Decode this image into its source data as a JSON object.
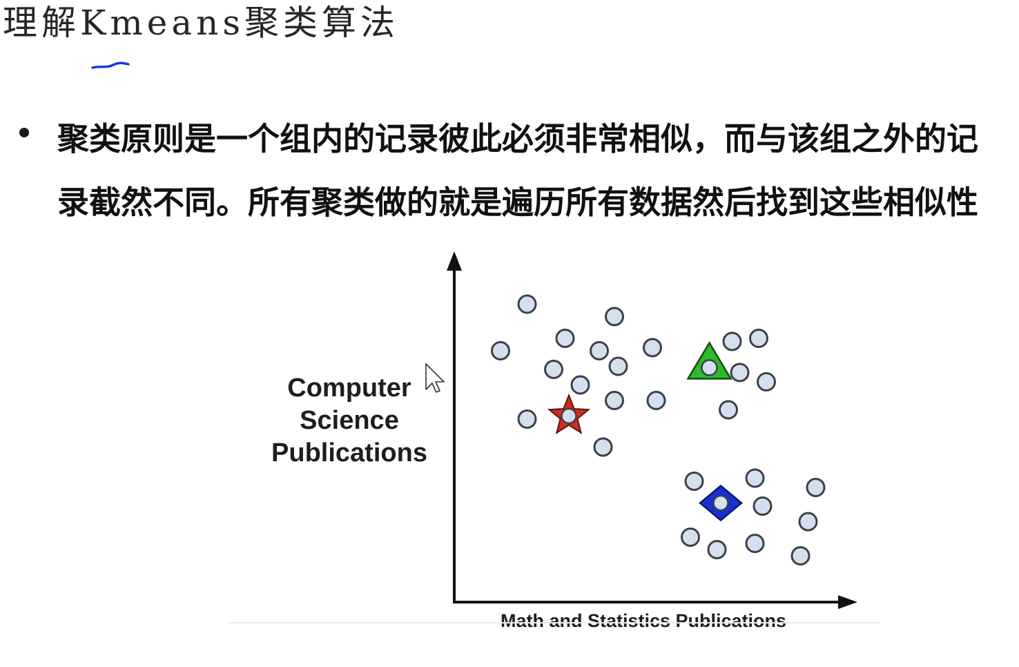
{
  "slide": {
    "title": "理解Kmeans聚类算法",
    "bullet": "聚类原则是一个组内的记录彼此必须非常相似，而与该组之外的记录截然不同。所有聚类做的就是遍历所有数据然后找到这些相似性"
  },
  "colors": {
    "point_fill": "#d4e0f0",
    "point_stroke": "#3c4046",
    "star_fill": "#d42a1e",
    "triangle_fill": "#2db82d",
    "diamond_fill": "#1a2fd0",
    "axis": "#111111",
    "annotation": "#1a37d8"
  },
  "chart_data": {
    "type": "scatter",
    "xlabel": "Math and Statistics Publications",
    "ylabel_lines": [
      "Computer",
      "Science",
      "Publications"
    ],
    "grid": false,
    "legend": "none",
    "xlim": [
      0,
      100
    ],
    "ylim": [
      0,
      100
    ],
    "series": [
      {
        "points": [
          [
            17,
            91
          ],
          [
            40,
            87
          ],
          [
            27,
            80
          ],
          [
            10,
            76
          ],
          [
            36,
            76
          ],
          [
            50,
            77
          ],
          [
            24,
            70
          ],
          [
            41,
            71
          ],
          [
            31,
            65
          ],
          [
            40,
            60
          ],
          [
            51,
            60
          ],
          [
            17,
            54
          ],
          [
            37,
            45
          ]
        ]
      },
      {
        "points": [
          [
            71,
            79
          ],
          [
            78,
            80
          ],
          [
            73,
            69
          ],
          [
            80,
            66
          ],
          [
            70,
            57
          ]
        ]
      },
      {
        "points": [
          [
            61,
            34
          ],
          [
            77,
            35
          ],
          [
            93,
            32
          ],
          [
            79,
            26
          ],
          [
            91,
            21
          ],
          [
            60,
            16
          ],
          [
            67,
            12
          ],
          [
            77,
            14
          ],
          [
            89,
            10
          ]
        ]
      }
    ],
    "centroids": [
      {
        "shape": "star",
        "x": 28,
        "y": 55
      },
      {
        "shape": "triangle",
        "x": 65,
        "y": 71
      },
      {
        "shape": "diamond",
        "x": 68,
        "y": 27
      }
    ]
  }
}
